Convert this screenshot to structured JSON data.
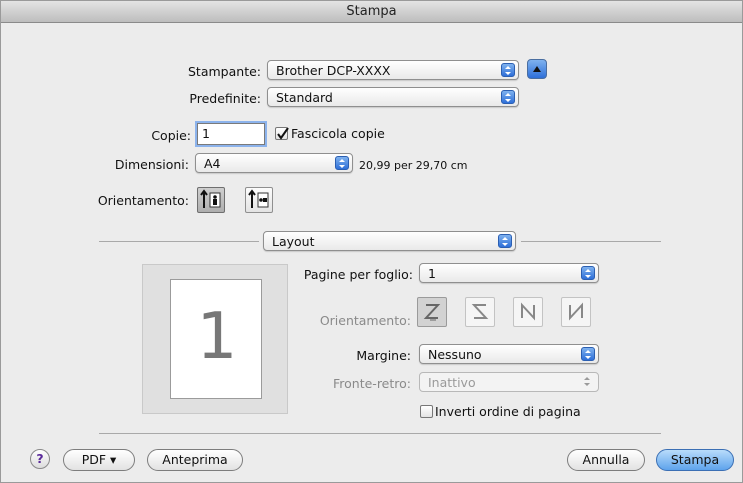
{
  "window": {
    "title": "Stampa"
  },
  "printer": {
    "label": "Stampante:",
    "value": "Brother DCP-XXXX"
  },
  "presets": {
    "label": "Predefinite:",
    "value": "Standard"
  },
  "copies": {
    "label": "Copie:",
    "value": "1",
    "collate_label": "Fascicola copie",
    "collate_checked": true
  },
  "paper_size": {
    "label": "Dimensioni:",
    "value": "A4",
    "size_text": "20,99 per 29,70 cm"
  },
  "orientation": {
    "label": "Orientamento:",
    "selected": "portrait"
  },
  "section": {
    "value": "Layout"
  },
  "layout": {
    "pages_per_sheet_label": "Pagine per foglio:",
    "pages_per_sheet_value": "1",
    "layout_direction_label": "Orientamento:",
    "border_label": "Margine:",
    "border_value": "Nessuno",
    "two_sided_label": "Fronte-retro:",
    "two_sided_value": "Inattivo",
    "reverse_label": "Inverti ordine di pagina",
    "reverse_checked": false
  },
  "preview": {
    "page_number": "1"
  },
  "buttons": {
    "help": "?",
    "pdf": "PDF ▾",
    "preview": "Anteprima",
    "cancel": "Annulla",
    "print": "Stampa"
  },
  "colors": {
    "accent": "#5ea3ec",
    "popup_arrow": "#2e6fd8"
  }
}
